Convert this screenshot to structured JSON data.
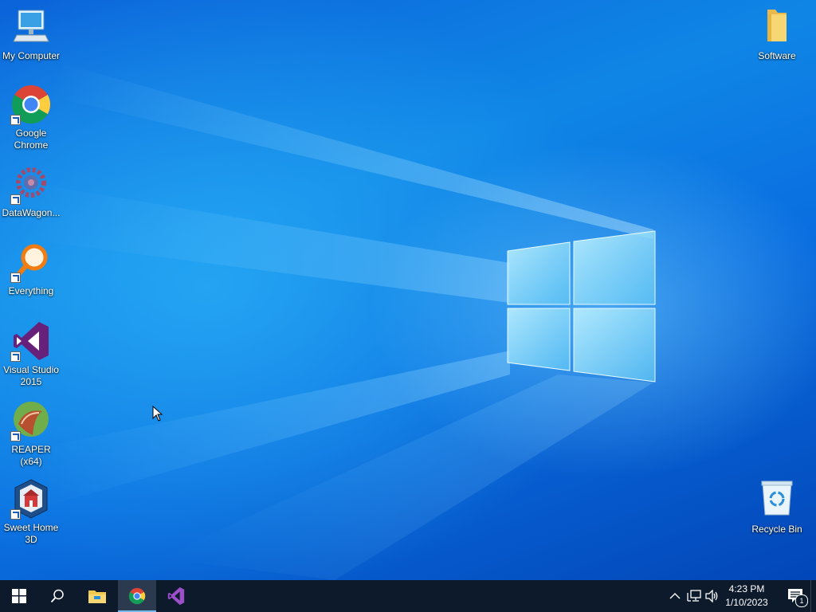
{
  "desktop": {
    "icons": [
      {
        "label": "My Computer",
        "icon": "computer-icon"
      },
      {
        "label": "Google Chrome",
        "icon": "chrome-icon"
      },
      {
        "label": "DataWagon...",
        "icon": "datawagon-icon"
      },
      {
        "label": "Everything",
        "icon": "everything-search-icon"
      },
      {
        "label": "Visual Studio 2015",
        "icon": "visual-studio-icon"
      },
      {
        "label": "REAPER (x64)",
        "icon": "reaper-icon"
      },
      {
        "label": "Sweet Home 3D",
        "icon": "sweet-home-3d-icon"
      },
      {
        "label": "Software",
        "icon": "folder-icon"
      },
      {
        "label": "Recycle Bin",
        "icon": "recycle-bin-icon"
      }
    ]
  },
  "taskbar": {
    "buttons": [
      {
        "name": "start",
        "icon": "windows-start-icon"
      },
      {
        "name": "search",
        "icon": "search-icon"
      },
      {
        "name": "file-explorer",
        "icon": "file-explorer-icon"
      },
      {
        "name": "chrome",
        "icon": "chrome-icon",
        "active": true
      },
      {
        "name": "visual-studio",
        "icon": "visual-studio-icon"
      }
    ],
    "tray": {
      "icons": [
        "chevron-up-icon",
        "network-icon",
        "volume-icon"
      ],
      "time": "4:23 PM",
      "date": "1/10/2023",
      "notification_count": "1"
    }
  },
  "colors": {
    "taskbar_bg": "#0d1a2b",
    "accent": "#76b9ed"
  }
}
